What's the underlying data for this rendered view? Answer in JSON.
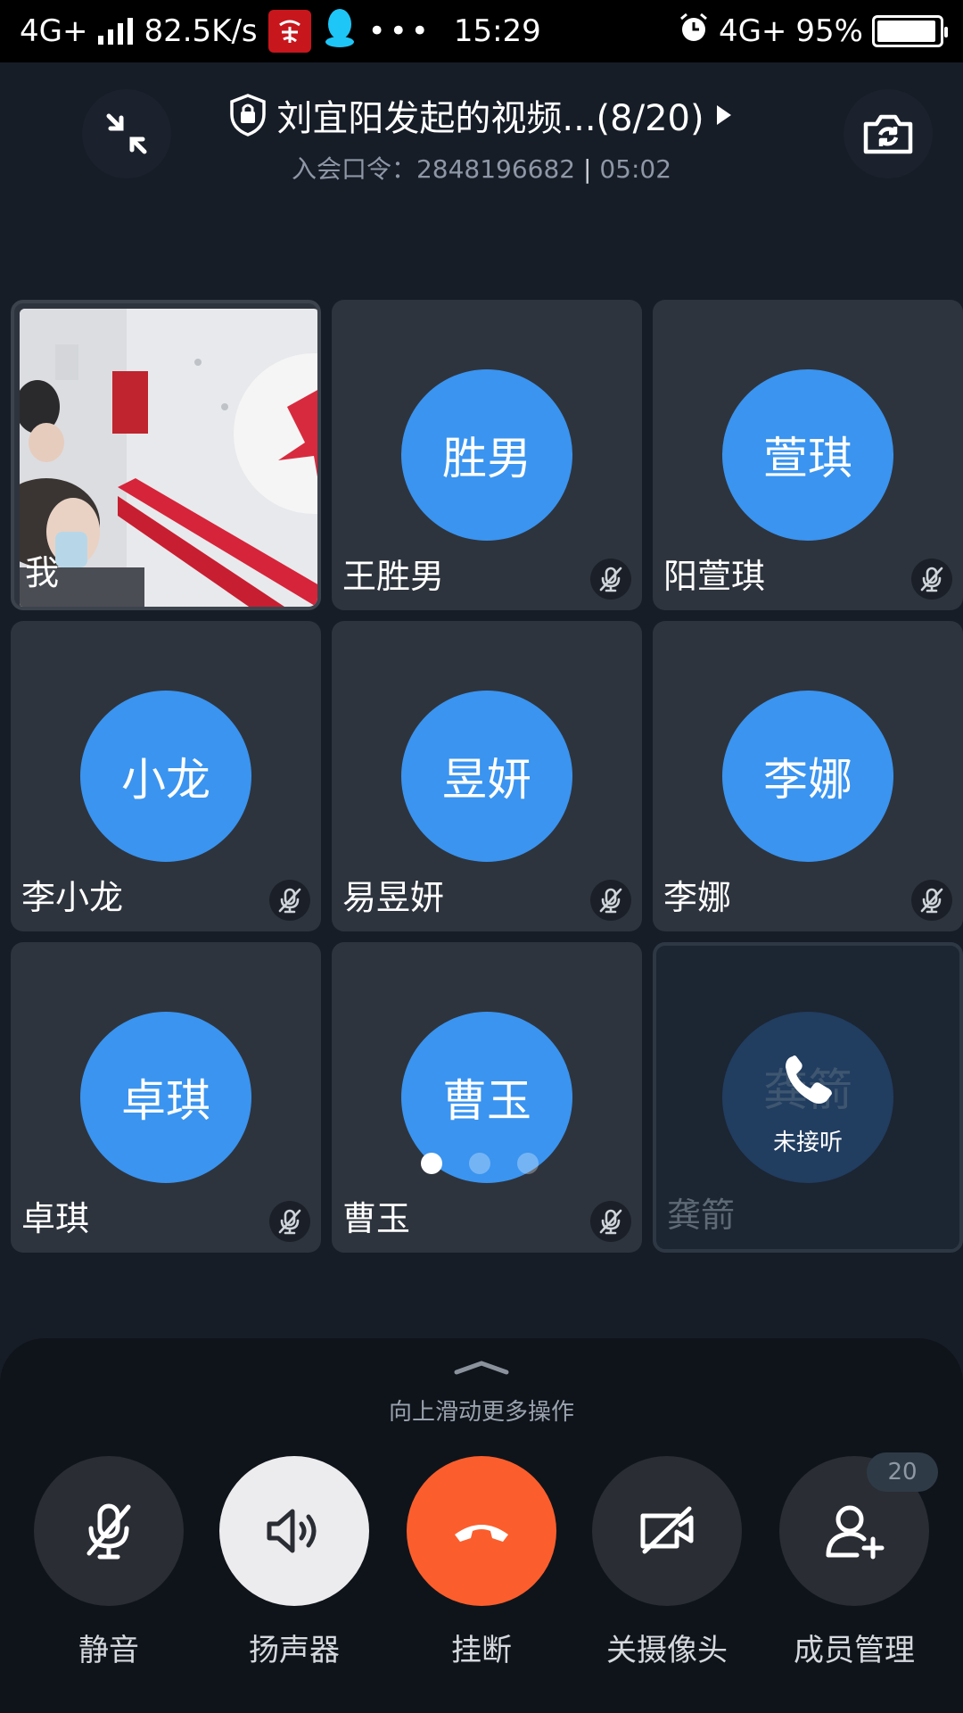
{
  "status_bar": {
    "network": "4G+",
    "speed": "82.5K/s",
    "time": "15:29",
    "network_right": "4G+",
    "battery": "95%"
  },
  "header": {
    "title": "刘宜阳发起的视频...(8/20)",
    "meeting_code": "入会口令：2848196682",
    "duration": "05:02"
  },
  "participants": [
    {
      "avatar": "",
      "name": "我",
      "self": true
    },
    {
      "avatar": "胜男",
      "name": "王胜男",
      "muted": true
    },
    {
      "avatar": "萱琪",
      "name": "阳萱琪",
      "muted": true
    },
    {
      "avatar": "小龙",
      "name": "李小龙",
      "muted": true
    },
    {
      "avatar": "昱妍",
      "name": "易昱妍",
      "muted": true
    },
    {
      "avatar": "李娜",
      "name": "李娜",
      "muted": true
    },
    {
      "avatar": "卓琪",
      "name": "卓琪",
      "muted": true
    },
    {
      "avatar": "曹玉",
      "name": "曹玉",
      "muted": true
    },
    {
      "avatar": "龚箭",
      "name": "龚箭",
      "status": "未接听"
    }
  ],
  "pagination": {
    "pages": 3,
    "current": 1
  },
  "panel": {
    "swipe_hint": "向上滑动更多操作",
    "controls": {
      "mute": "静音",
      "speaker": "扬声器",
      "hangup": "挂断",
      "camera_off": "关摄像头",
      "members": "成员管理",
      "member_count": "20"
    }
  },
  "colors": {
    "avatar": "#3a94f0",
    "hangup": "#fb5e2c",
    "background": "#171d27"
  }
}
